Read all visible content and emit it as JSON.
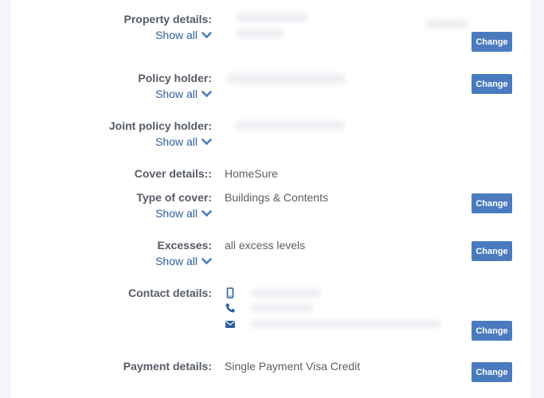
{
  "rows": {
    "property": {
      "label": "Property details:",
      "show_all": "Show all"
    },
    "policy_holder": {
      "label": "Policy holder:",
      "show_all": "Show all"
    },
    "joint_holder": {
      "label": "Joint policy holder:",
      "show_all": "Show all"
    },
    "cover": {
      "label": "Cover details::",
      "value": "HomeSure"
    },
    "type_cover": {
      "label": "Type of cover:",
      "show_all": "Show all",
      "value": "Buildings & Contents"
    },
    "excesses": {
      "label": "Excesses:",
      "show_all": "Show all",
      "value": "all excess levels"
    },
    "contact": {
      "label": "Contact details:"
    },
    "payment": {
      "label": "Payment details:",
      "value": "Single Payment Visa Credit"
    }
  },
  "change_label": "Change",
  "colors": {
    "accent": "#4a7bbf",
    "link": "#2f5f9e",
    "label": "#555c66"
  },
  "icons": {
    "mobile": "mobile-icon",
    "phone": "phone-icon",
    "email": "envelope-icon",
    "expand": "chevron-down-icon"
  }
}
